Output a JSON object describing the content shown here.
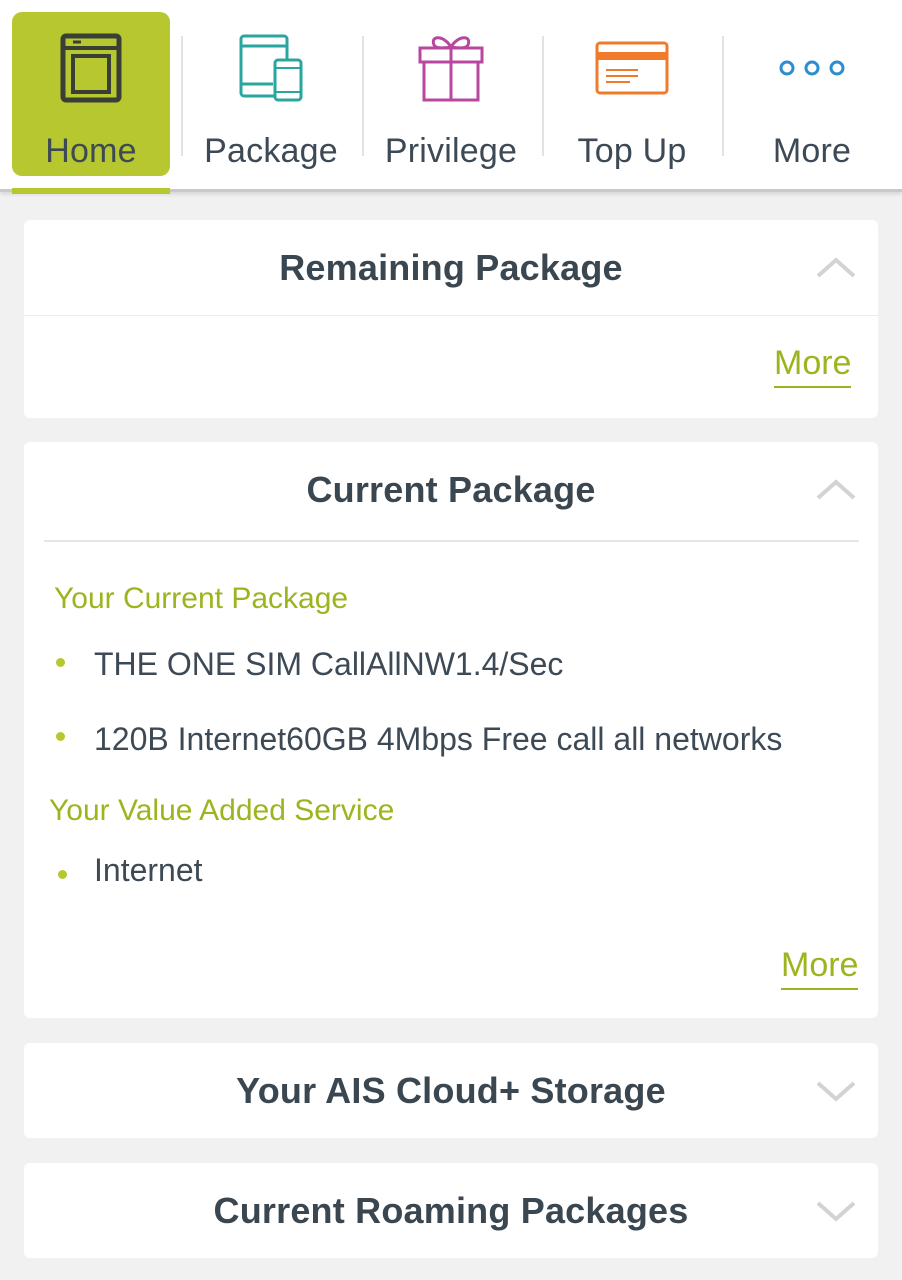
{
  "nav": {
    "items": [
      {
        "label": "Home",
        "icon": "home-icon",
        "active": true
      },
      {
        "label": "Package",
        "icon": "devices-icon",
        "active": false
      },
      {
        "label": "Privilege",
        "icon": "gift-icon",
        "active": false
      },
      {
        "label": "Top Up",
        "icon": "card-icon",
        "active": false
      },
      {
        "label": "More",
        "icon": "more-dots-icon",
        "active": false
      }
    ]
  },
  "remaining": {
    "title": "Remaining Package",
    "more": "More",
    "expanded": true
  },
  "current": {
    "title": "Current Package",
    "expanded": true,
    "package_heading": "Your Current Package",
    "packages": [
      "THE ONE SIM CallAllNW1.4/Sec",
      "120B Internet60GB 4Mbps Free call all networks"
    ],
    "vas_heading": "Your Value Added Service",
    "vas": [
      "Internet"
    ],
    "more": "More"
  },
  "cloud": {
    "title": "Your AIS Cloud+ Storage",
    "expanded": false
  },
  "roaming": {
    "title": "Current Roaming Packages",
    "expanded": false
  },
  "colors": {
    "accent": "#b6c730",
    "link": "#9eb41e",
    "text": "#3d4a55",
    "icon_teal": "#2aa5a0",
    "icon_magenta": "#b8479e",
    "icon_orange": "#f07b2b",
    "icon_blue": "#2b8fcf"
  }
}
